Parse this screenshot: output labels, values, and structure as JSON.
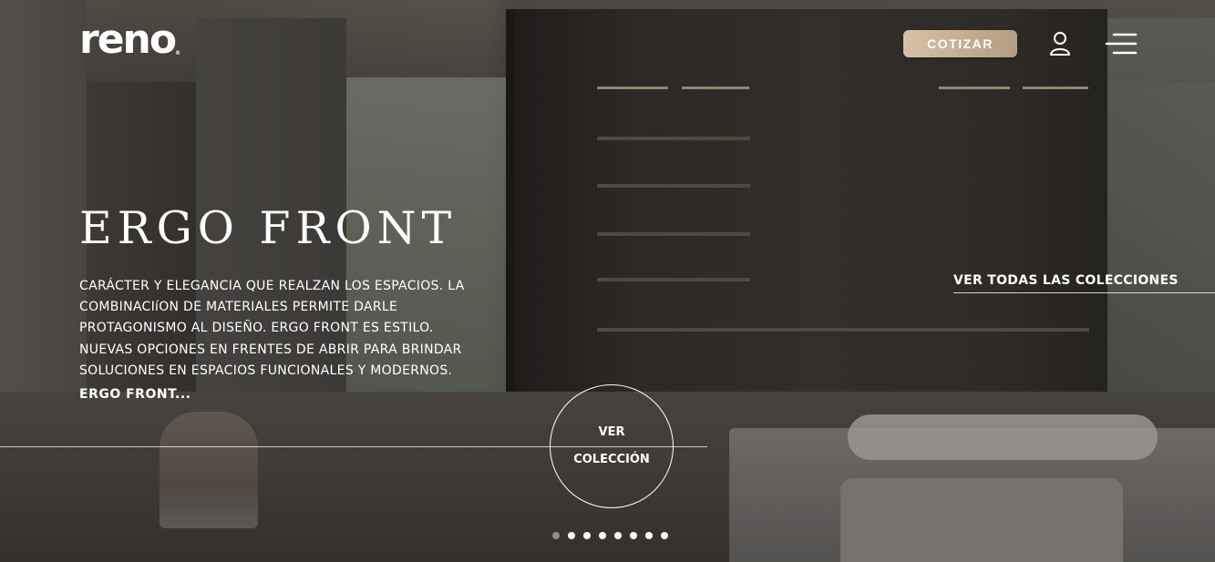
{
  "header": {
    "logo_text": "reno",
    "logo_mark": "®",
    "quote_button": "COTIZAR",
    "user_icon": "user-icon",
    "menu_icon": "menu-icon"
  },
  "hero": {
    "title": "ERGO FRONT",
    "description": "CARÁCTER Y ELEGANCIA QUE REALZAN LOS ESPACIOS. LA COMBINACIíON DE MATERIALES PERMITE DARLE PROTAGONISMO AL DISEÑO. ERGO FRONT ES ESTILO. NUEVAS OPCIONES EN FRENTES DE ABRIR PARA BRINDAR SOLUCIONES EN ESPACIOS FUNCIONALES Y MODERNOS.",
    "more_link": "ERGO FRONT...",
    "view_collection_line1": "VER",
    "view_collection_line2": "COLECCIÓN",
    "all_collections_link": "VER TODAS LAS COLECCIONES"
  },
  "carousel": {
    "total_slides": 8,
    "active_slide": 1
  },
  "colors": {
    "accent": "#c8b090",
    "text": "#ffffff"
  }
}
